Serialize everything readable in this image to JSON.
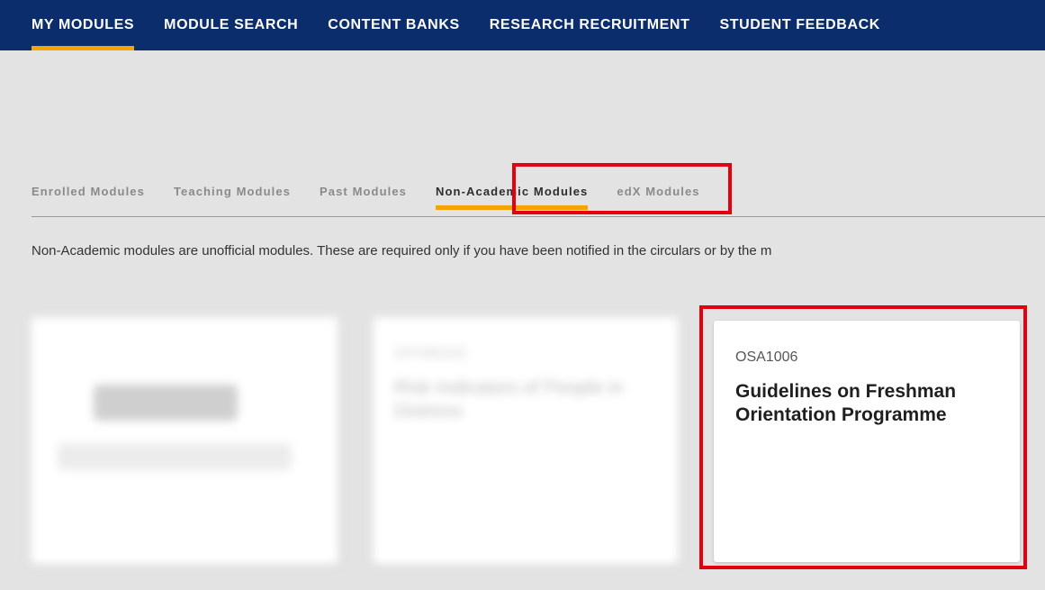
{
  "topnav": {
    "items": [
      {
        "label": "MY MODULES"
      },
      {
        "label": "MODULE SEARCH"
      },
      {
        "label": "CONTENT BANKS"
      },
      {
        "label": "RESEARCH RECRUITMENT"
      },
      {
        "label": "STUDENT FEEDBACK"
      }
    ],
    "active_item": "MY MODULES"
  },
  "tabs": {
    "items": [
      {
        "label": "Enrolled Modules"
      },
      {
        "label": "Teaching Modules"
      },
      {
        "label": "Past Modules"
      },
      {
        "label": "Non-Academic Modules"
      },
      {
        "label": "edX Modules"
      }
    ],
    "active_tab": "Non-Academic Modules"
  },
  "notice": {
    "text": "Non-Academic modules are unofficial modules. These are required only if you have been notified in the circulars or by the m"
  },
  "cards": [
    {
      "code": "",
      "title": ""
    },
    {
      "code": "CFCM1101",
      "title": "Risk Indicators of People in Distress"
    },
    {
      "code": "OSA1006",
      "title": "Guidelines on Freshman Orientation Programme"
    }
  ],
  "colors": {
    "nav_background": "#0b2d6b",
    "accent": "#f5a300",
    "highlight": "#e3000f",
    "page_background": "#e3e3e3"
  }
}
